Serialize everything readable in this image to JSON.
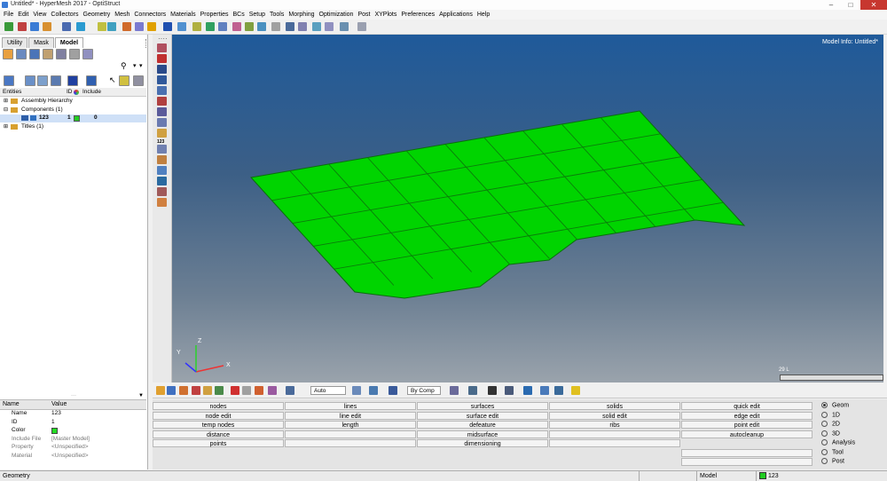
{
  "window": {
    "title": "Untitled* - HyperMesh 2017 - OptiStruct"
  },
  "menubar": [
    "File",
    "Edit",
    "View",
    "Collectors",
    "Geometry",
    "Mesh",
    "Connectors",
    "Materials",
    "Properties",
    "BCs",
    "Setup",
    "Tools",
    "Morphing",
    "Optimization",
    "Post",
    "XYPlots",
    "Preferences",
    "Applications",
    "Help"
  ],
  "tabs": [
    {
      "label": "Utility"
    },
    {
      "label": "Mask"
    },
    {
      "label": "Model"
    }
  ],
  "entity_header": {
    "entities": "Entities",
    "id": "ID",
    "include": "Include"
  },
  "tree": [
    {
      "label": "Assembly Hierarchy"
    },
    {
      "label": "Components (1)"
    },
    {
      "label": "123",
      "id": "1",
      "include": "0",
      "color": "#22cc22"
    },
    {
      "label": "Titles (1)"
    }
  ],
  "props_header": {
    "name": "Name",
    "value": "Value"
  },
  "props": [
    {
      "name": "Name",
      "value": "123"
    },
    {
      "name": "ID",
      "value": "1"
    },
    {
      "name": "Color",
      "value": "",
      "color": "#22dd22"
    },
    {
      "name": "Include File",
      "value": "[Master Model]"
    },
    {
      "name": "Property",
      "value": "<Unspecified>"
    },
    {
      "name": "Material",
      "value": "<Unspecified>"
    }
  ],
  "viewport": {
    "model_info": "Model Info: Untitled*",
    "scale_label": "29 L",
    "mesh_color": "#00d400",
    "axis": {
      "x": "X",
      "y": "Y",
      "z": "Z"
    }
  },
  "bottom_toolbar": {
    "mode": "Auto",
    "color_by": "By Comp"
  },
  "vtool_label": "123",
  "panel_buttons": {
    "col1": [
      "nodes",
      "node edit",
      "temp nodes",
      "distance",
      "points"
    ],
    "col2": [
      "lines",
      "line edit",
      "length"
    ],
    "col3": [
      "surfaces",
      "surface edit",
      "defeature",
      "midsurface",
      "dimensioning"
    ],
    "col4": [
      "solids",
      "solid edit",
      "ribs"
    ],
    "col5": [
      "quick edit",
      "edge edit",
      "point edit",
      "autocleanup"
    ]
  },
  "radios": [
    {
      "label": "Geom",
      "checked": true
    },
    {
      "label": "1D",
      "checked": false
    },
    {
      "label": "2D",
      "checked": false
    },
    {
      "label": "3D",
      "checked": false
    },
    {
      "label": "Analysis",
      "checked": false
    },
    {
      "label": "Tool",
      "checked": false
    },
    {
      "label": "Post",
      "checked": false
    }
  ],
  "status": {
    "left": "Geometry",
    "model": "Model",
    "component": "123",
    "component_color": "#22cc22"
  }
}
